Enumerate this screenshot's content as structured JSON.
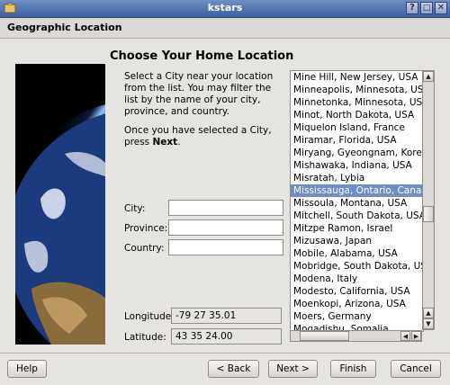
{
  "window": {
    "title": "kstars",
    "controls": [
      "?",
      "□",
      "✕"
    ]
  },
  "header": {
    "title": "Geographic Location"
  },
  "main": {
    "heading": "Choose Your Home Location",
    "description": "Select a City near your location from the list. You may filter the list by the name of your city, province, and country.",
    "instruction_prefix": "Once you have selected a City, press ",
    "instruction_bold": "Next",
    "instruction_suffix": "."
  },
  "filters": {
    "city_label": "City:",
    "province_label": "Province:",
    "country_label": "Country:",
    "city_value": "",
    "province_value": "",
    "country_value": ""
  },
  "coords": {
    "longitude_label": "Longitude:",
    "longitude_value": "-79 27 35.01",
    "latitude_label": "Latitude:",
    "latitude_value": "43 35 24.00"
  },
  "cities": [
    "Mine Hill, New Jersey, USA",
    "Minneapolis, Minnesota, USA",
    "Minnetonka, Minnesota, USA",
    "Minot, North Dakota, USA",
    "Miquelon Island, France",
    "Miramar, Florida, USA",
    "Miryang, Gyeongnam, Korea",
    "Mishawaka, Indiana, USA",
    "Misratah, Lybia",
    "Mississauga, Ontario, Canada",
    "Missoula, Montana, USA",
    "Mitchell, South Dakota, USA",
    "Mitzpe Ramon, Israel",
    "Mizusawa, Japan",
    "Mobile, Alabama, USA",
    "Mobridge, South Dakota, USA",
    "Modena, Italy",
    "Modesto, California, USA",
    "Moenkopi, Arizona, USA",
    "Moers, Germany",
    "Mogadishu, Somalia"
  ],
  "selected_city": "Mississauga, Ontario, Canada",
  "buttons": {
    "help": "Help",
    "back": "< Back",
    "next": "Next >",
    "finish": "Finish",
    "cancel": "Cancel"
  }
}
